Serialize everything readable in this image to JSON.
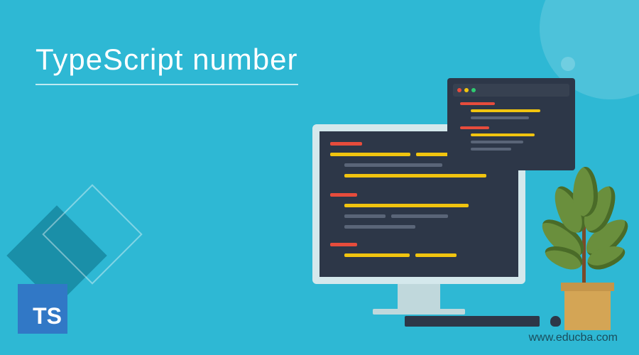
{
  "title": "TypeScript number",
  "logo_text": "TS",
  "url": "www.educba.com",
  "colors": {
    "bg": "#2eb8d4",
    "screen": "#2d3748",
    "logo_bg": "#3178c6",
    "code_red": "#e74c3c",
    "code_yellow": "#f1c40f",
    "code_gray": "#5a6578",
    "leaf": "#6a8f3d",
    "pot": "#d4a555"
  }
}
